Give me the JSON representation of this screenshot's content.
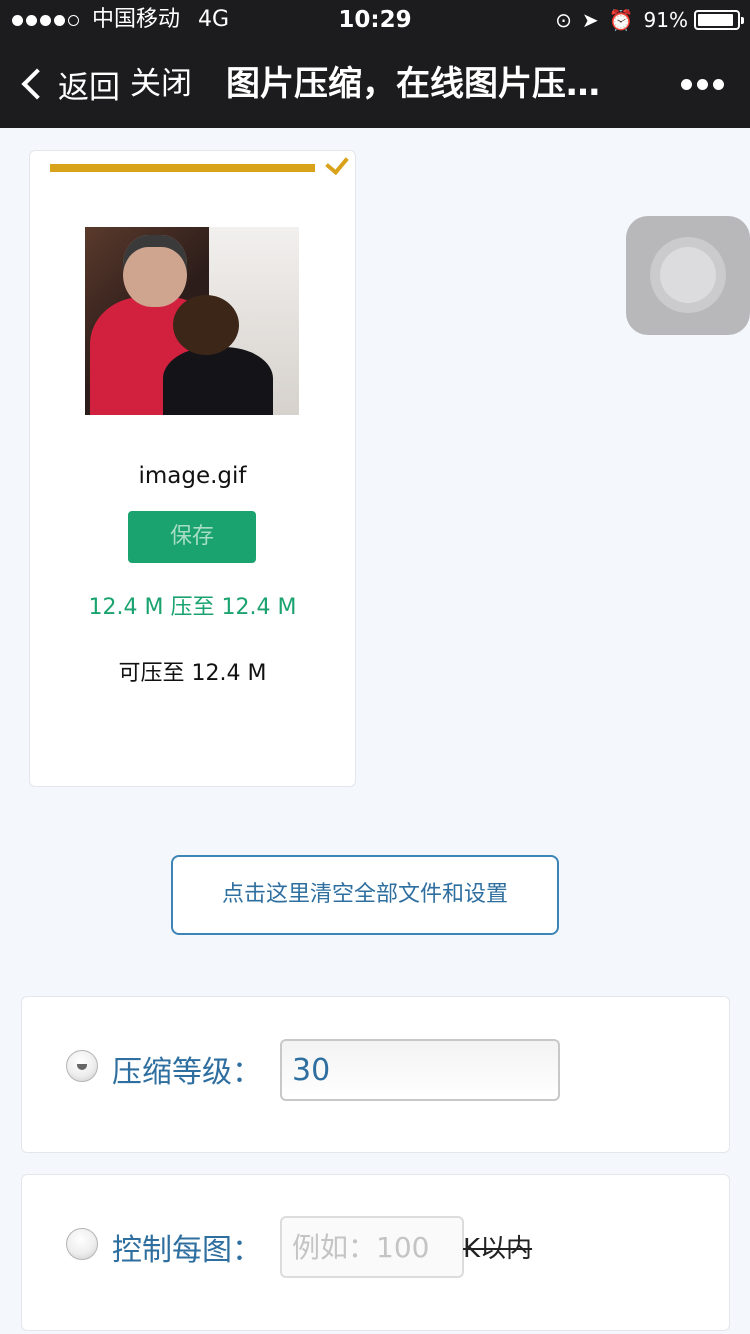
{
  "status_bar": {
    "carrier": "中国移动",
    "network": "4G",
    "time": "10:29",
    "battery_text": "91%",
    "battery_level": 0.91,
    "signal_bars_filled": 4,
    "signal_bars_total": 5,
    "icons": [
      "orientation-lock-icon",
      "location-arrow-icon",
      "alarm-icon"
    ]
  },
  "nav": {
    "back_label": "返回",
    "close_label": "关闭",
    "title": "图片压缩，在线图片压…",
    "more_icon": "more-dots-icon"
  },
  "file_card": {
    "filename": "image.gif",
    "save_label": "保存",
    "ratio_text": "12.4 M 压至 12.4 M",
    "max_text": "可压至 12.4 M",
    "progress": 1.0,
    "complete_icon": "check-icon",
    "accent_color": "#d9a21b",
    "status_color": "#1aa36f"
  },
  "clear_button": {
    "label": "点击这里清空全部文件和设置"
  },
  "options": {
    "level": {
      "label": "压缩等级：",
      "value": "30",
      "selected": true
    },
    "size": {
      "label": "控制每图：",
      "placeholder": "例如：100",
      "unit": "K以内",
      "selected": false
    }
  },
  "colors": {
    "bar_bg": "#1c1c1e",
    "link_blue": "#2f6fa0",
    "page_bg": "#f4f7fb"
  }
}
